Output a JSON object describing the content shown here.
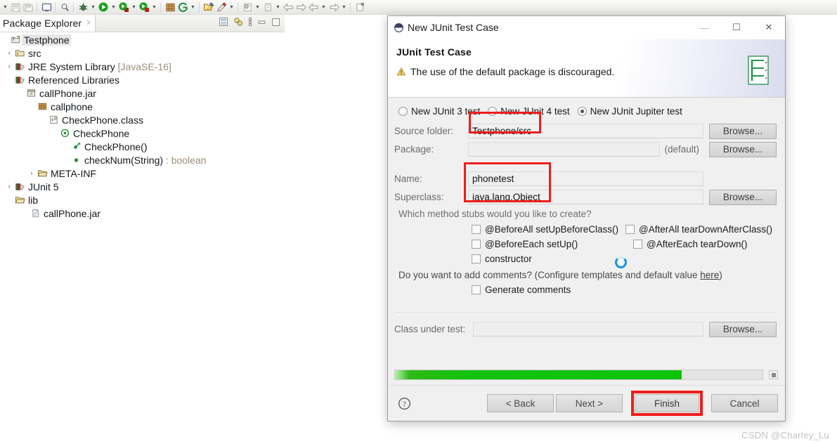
{
  "ide": {
    "toolbar": {
      "items": [
        {
          "icon": "dropdown-arrow",
          "name": "toolbar-dropdown-arrow"
        },
        {
          "icon": "save-icon",
          "name": "toolbar-save"
        },
        {
          "icon": "save-all-icon",
          "name": "toolbar-save-all"
        },
        {
          "icon": "console-icon",
          "name": "toolbar-console"
        },
        {
          "icon": "search-icon",
          "name": "toolbar-search"
        },
        {
          "icon": "debug-icon",
          "name": "toolbar-debug"
        },
        {
          "icon": "run-icon",
          "name": "toolbar-run"
        },
        {
          "icon": "coverage-icon",
          "name": "toolbar-coverage"
        },
        {
          "icon": "profile-icon",
          "name": "toolbar-profile"
        },
        {
          "icon": "new-package-icon",
          "name": "toolbar-new-package"
        },
        {
          "icon": "git-icon",
          "name": "toolbar-git"
        },
        {
          "icon": "open-type-icon",
          "name": "toolbar-open-type"
        },
        {
          "icon": "open-task-icon",
          "name": "toolbar-open-task"
        },
        {
          "icon": "new-class-icon",
          "name": "toolbar-new-class"
        },
        {
          "icon": "new-element-icon",
          "name": "toolbar-new-element"
        },
        {
          "icon": "back-icon",
          "name": "toolbar-back"
        },
        {
          "icon": "forward-icon",
          "name": "toolbar-forward"
        },
        {
          "icon": "prev-annotation-icon",
          "name": "toolbar-prev-annotation"
        },
        {
          "icon": "next-annotation-icon",
          "name": "toolbar-next-annotation"
        },
        {
          "icon": "last-edit-icon",
          "name": "toolbar-last-edit"
        }
      ]
    },
    "package_explorer": {
      "tab_label": "Package Explorer",
      "close_glyph": "☓",
      "view_tools": [
        {
          "name": "collapse-all-icon"
        },
        {
          "name": "link-with-editor-icon"
        },
        {
          "name": "view-menu-icon"
        },
        {
          "name": "minimize-icon"
        },
        {
          "name": "maximize-icon"
        }
      ],
      "tree": [
        {
          "indent": 0,
          "arrow": "",
          "icon": "java-project-icon",
          "label": "Testphone",
          "selected": true
        },
        {
          "indent": 1,
          "arrow": "›",
          "icon": "source-folder-icon",
          "label": "src"
        },
        {
          "indent": 1,
          "arrow": "›",
          "icon": "library-icon",
          "label": "JRE System Library",
          "suffix": "[JavaSE-16]"
        },
        {
          "indent": 1,
          "arrow": "ⱟ",
          "icon": "library-icon",
          "label": "Referenced Libraries"
        },
        {
          "indent": 2,
          "arrow": "ⱟ",
          "icon": "jar-icon",
          "label": "callPhone.jar"
        },
        {
          "indent": 3,
          "arrow": "ⱟ",
          "icon": "package-icon",
          "label": "callphone"
        },
        {
          "indent": 4,
          "arrow": "ⱟ",
          "icon": "class-file-icon",
          "label": "CheckPhone.class"
        },
        {
          "indent": 5,
          "arrow": "ⱟ",
          "icon": "class-icon",
          "label": "CheckPhone"
        },
        {
          "indent": 6,
          "arrow": "",
          "icon": "constructor-icon",
          "label": "CheckPhone()"
        },
        {
          "indent": 6,
          "arrow": "",
          "icon": "method-icon",
          "label": "checkNum(String)",
          "suffix": ": boolean"
        },
        {
          "indent": 3,
          "arrow": "›",
          "icon": "folder-icon",
          "label": "META-INF"
        },
        {
          "indent": 1,
          "arrow": "›",
          "icon": "library-icon",
          "label": "JUnit 5"
        },
        {
          "indent": 1,
          "arrow": "ⱟ",
          "icon": "folder-icon",
          "label": "lib"
        },
        {
          "indent": 2,
          "arrow": "",
          "icon": "file-icon",
          "label": "callPhone.jar"
        }
      ]
    }
  },
  "dialog": {
    "title": "New JUnit Test Case",
    "window_buttons": {
      "minimize": "—",
      "maximize": "☐",
      "close": "✕"
    },
    "header": {
      "title": "JUnit Test Case",
      "message": "The use of the default package is discouraged.",
      "message_icon": "warning-icon",
      "badge_icon": "junit-wizard-icon"
    },
    "junit_version": {
      "options": [
        {
          "label": "New JUnit 3 test",
          "selected": false
        },
        {
          "label": "New JUnit 4 test",
          "selected": false
        },
        {
          "label": "New JUnit Jupiter test",
          "selected": true
        }
      ]
    },
    "fields": {
      "source_folder": {
        "label": "Source folder:",
        "value": "Testphone/src",
        "browse": "Browse...",
        "highlighted": true
      },
      "package": {
        "label": "Package:",
        "value": "",
        "suffix": "(default)",
        "browse": "Browse...",
        "highlighted": false
      },
      "name": {
        "label": "Name:",
        "value": "phonetest",
        "highlighted": true
      },
      "superclass": {
        "label": "Superclass:",
        "value": "java.lang.Object",
        "browse": "Browse...",
        "highlighted": true
      },
      "class_under_test": {
        "label": "Class under test:",
        "value": "",
        "browse": "Browse...",
        "highlighted": false
      }
    },
    "stubs": {
      "question": "Which method stubs would you like to create?",
      "rows": [
        [
          {
            "label": "@BeforeAll setUpBeforeClass()",
            "checked": false
          },
          {
            "label": "@AfterAll tearDownAfterClass()",
            "checked": false
          }
        ],
        [
          {
            "label": "@BeforeEach setUp()",
            "checked": false
          },
          {
            "label": "@AfterEach tearDown()",
            "checked": false
          }
        ],
        [
          {
            "label": "constructor",
            "checked": false
          }
        ]
      ]
    },
    "comments": {
      "question_prefix": "Do you want to add comments? (Configure templates and default value ",
      "link": "here",
      "question_suffix": ")",
      "checkbox": {
        "label": "Generate comments",
        "checked": false
      }
    },
    "progress": {
      "percent": 78
    },
    "footer": {
      "help_icon": "help-icon",
      "back": "< Back",
      "next": "Next >",
      "finish": "Finish",
      "cancel": "Cancel",
      "finish_highlighted": true
    },
    "busy_indicator": "loading-spinner"
  },
  "watermark": "CSDN @Charley_Lu",
  "colors": {
    "accent_red": "#ee1d1d",
    "progress_green": "#0cc406",
    "dialog_bg": "#f0f0f0",
    "selection_gray": "#e6e6e6",
    "dim_text": "#9c8f78"
  }
}
